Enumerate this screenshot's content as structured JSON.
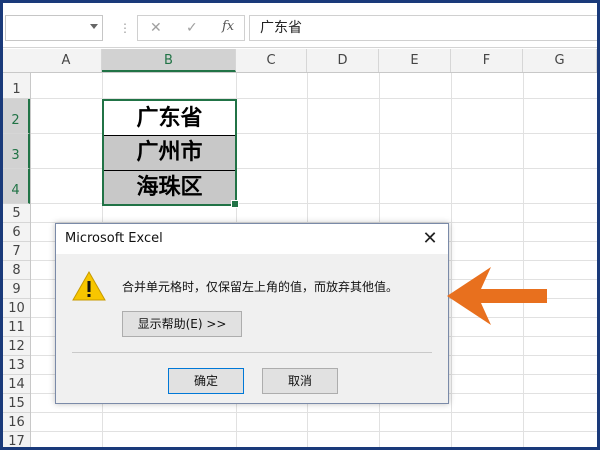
{
  "formula_bar": {
    "namebox_value": "",
    "separator": "⋮",
    "cancel_glyph": "✕",
    "enter_glyph": "✓",
    "fx_label": "fx",
    "formula_value": "广东省"
  },
  "grid": {
    "columns": [
      "A",
      "B",
      "C",
      "D",
      "E",
      "F",
      "G"
    ],
    "selected_column": "B",
    "rows": [
      "1",
      "2",
      "3",
      "4",
      "5",
      "6",
      "7",
      "8",
      "9",
      "10",
      "11",
      "12",
      "13",
      "14",
      "15",
      "16",
      "17"
    ],
    "selected_rows": [
      "2",
      "3",
      "4"
    ],
    "merged_cells": [
      "广东省",
      "广州市",
      "海珠区"
    ]
  },
  "dialog": {
    "title": "Microsoft Excel",
    "close_glyph": "✕",
    "message": "合并单元格时，仅保留左上角的值，而放弃其他值。",
    "help_button": "显示帮助(E) >>",
    "ok_button": "确定",
    "cancel_button": "取消",
    "icon": "warning-icon"
  },
  "colors": {
    "accent_green": "#217346",
    "arrow_orange": "#e8701e",
    "frame_blue": "#1a3a7a"
  }
}
